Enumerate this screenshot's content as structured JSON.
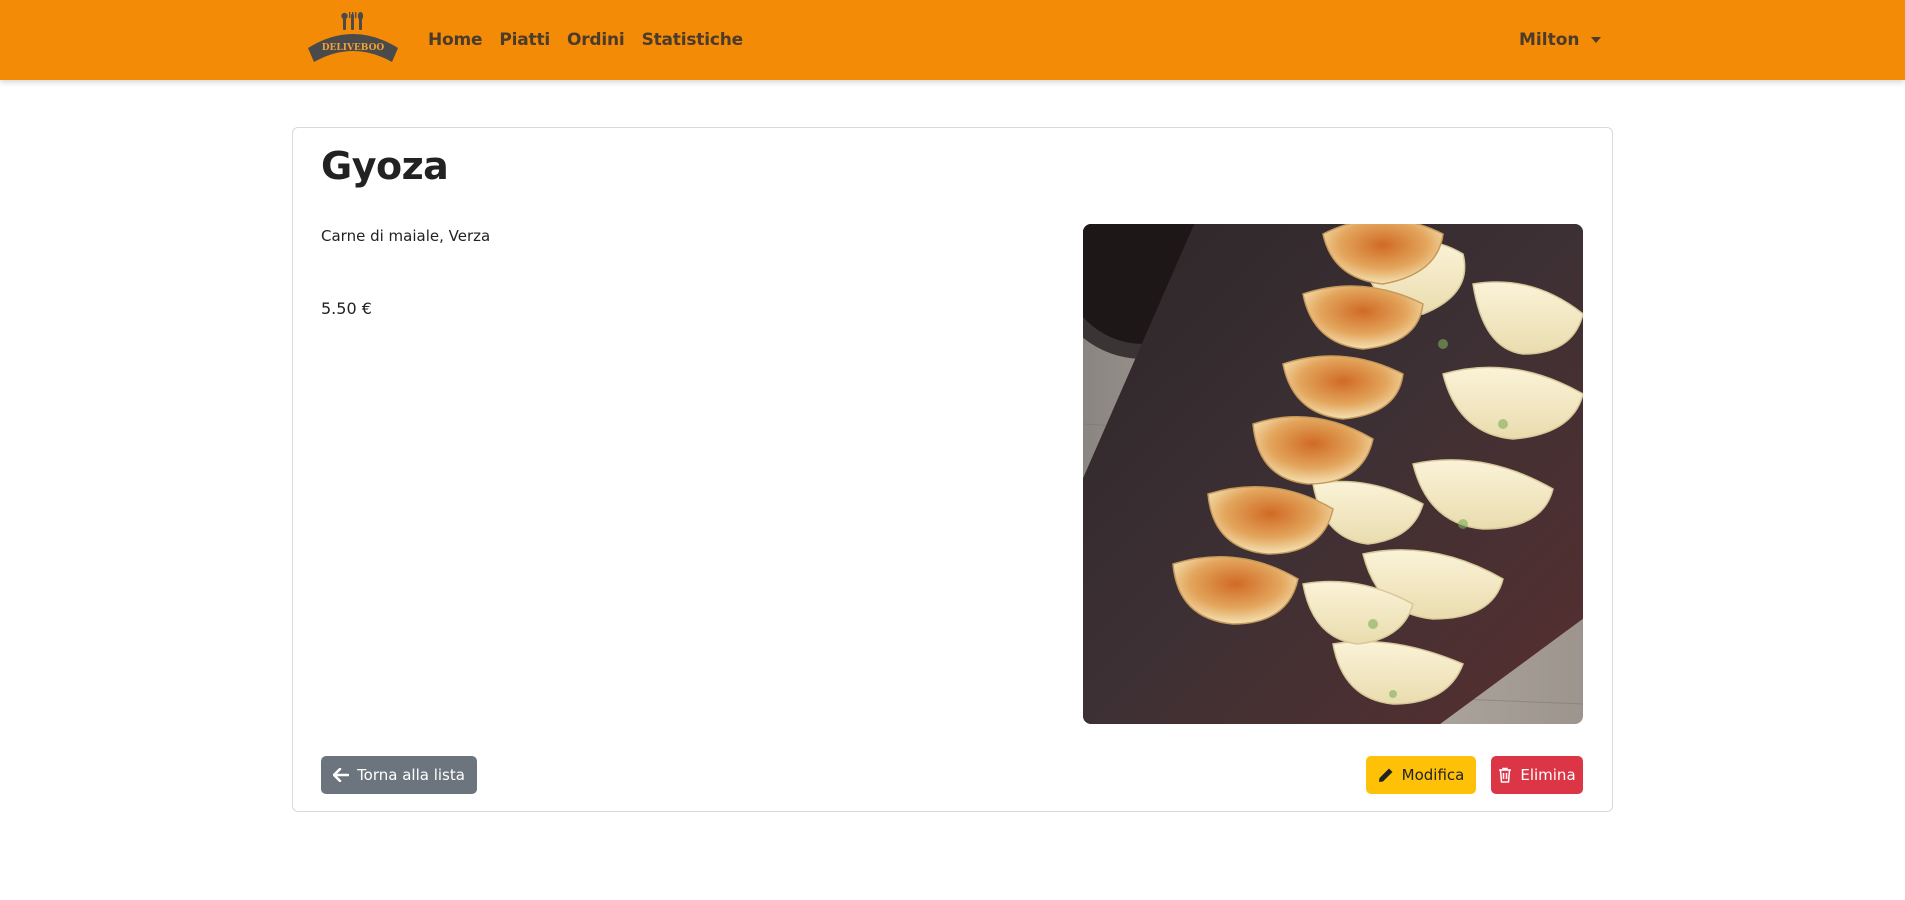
{
  "brand": {
    "logo_text": "DELIVEBOO",
    "logo_icon": "cutlery-icon"
  },
  "nav": {
    "links": [
      {
        "label": "Home"
      },
      {
        "label": "Piatti"
      },
      {
        "label": "Ordini"
      },
      {
        "label": "Statistiche"
      }
    ],
    "user": {
      "name": "Milton",
      "icon": "chevron-down-icon"
    }
  },
  "dish": {
    "name": "Gyoza",
    "ingredients": "Carne di maiale, Verza",
    "price": "5.50 €"
  },
  "actions": {
    "back_label": "Torna alla lista",
    "edit_label": "Modifica",
    "delete_label": "Elimina"
  },
  "colors": {
    "navbar": "#f48b07",
    "back_button": "#6c757d",
    "edit_button": "#ffc107",
    "delete_button": "#dc3545"
  }
}
